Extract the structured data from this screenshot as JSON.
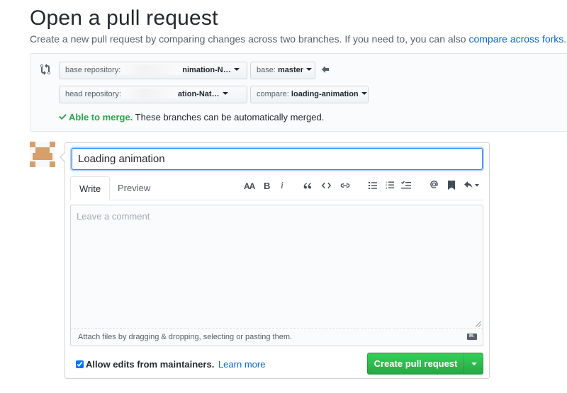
{
  "page": {
    "title": "Open a pull request",
    "subtitle": "Create a new pull request by comparing changes across two branches. If you need to, you can also ",
    "forks_link": "compare across forks",
    "subtitle_end": "."
  },
  "range": {
    "base_repo_label": "base repository:",
    "base_repo_value": "nimation-N…",
    "base_branch_label": "base:",
    "base_branch_value": "master",
    "head_repo_label": "head repository:",
    "head_repo_value": "ation-Nat…",
    "compare_label": "compare:",
    "compare_value": "loading-animation",
    "merge_ok": "Able to merge.",
    "merge_text": " These branches can be automatically merged."
  },
  "form": {
    "title_value": "Loading animation",
    "tab_write": "Write",
    "tab_preview": "Preview",
    "toolbar": {
      "header": "AA",
      "bold": "B",
      "italic": "i"
    },
    "comment_placeholder": "Leave a comment",
    "attach_text": "Attach files by dragging & dropping, selecting or pasting them.",
    "md_badge": "M↓",
    "allow_edits_label": "Allow edits from maintainers.",
    "learn_more": "Learn more",
    "submit_label": "Create pull request"
  },
  "colors": {
    "accent_blue": "#0366d6",
    "success_green": "#28a745",
    "avatar_tan": "#d89f6b"
  },
  "icons": [
    "git-compare-icon",
    "arrow-left-icon",
    "check-icon",
    "quote-icon",
    "code-icon",
    "link-icon",
    "unordered-list-icon",
    "ordered-list-icon",
    "task-list-icon",
    "mention-icon",
    "bookmark-icon",
    "reply-icon",
    "markdown-icon"
  ]
}
